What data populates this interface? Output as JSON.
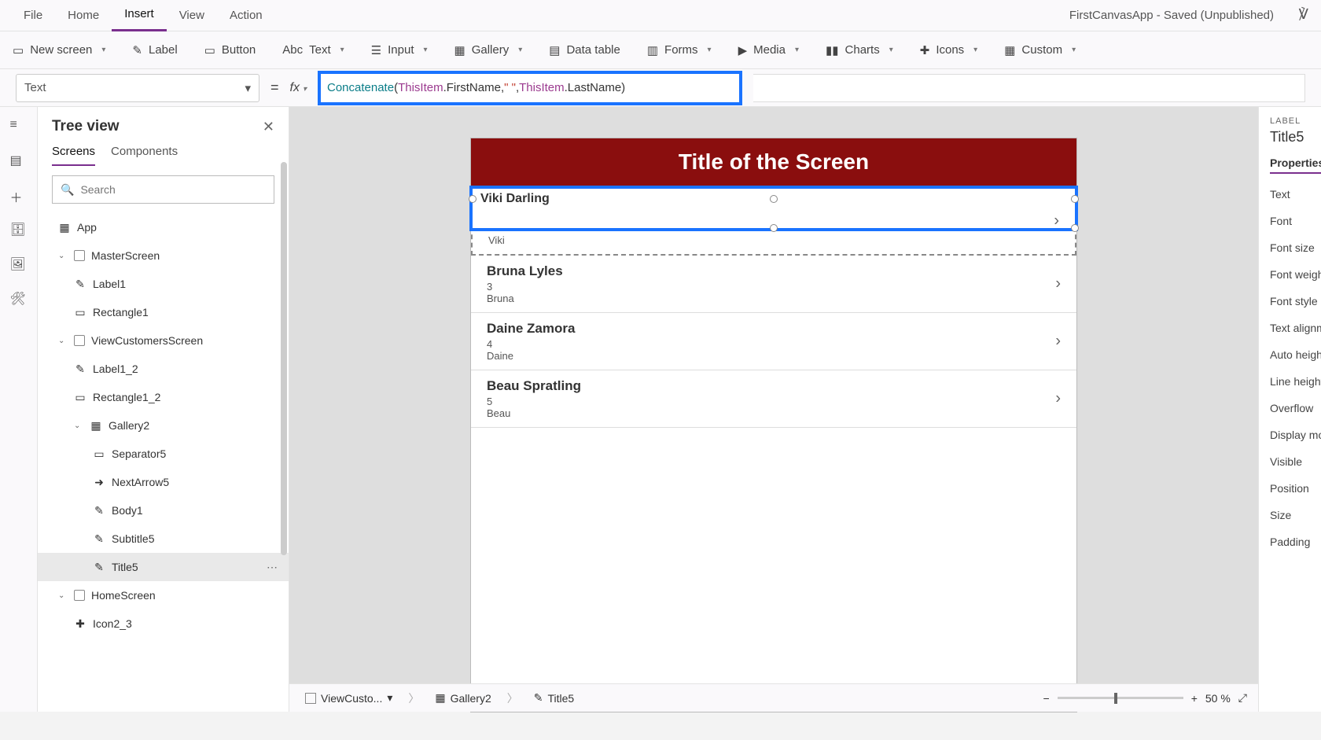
{
  "menu": {
    "items": [
      "File",
      "Home",
      "Insert",
      "View",
      "Action"
    ],
    "active": "Insert",
    "app_title": "FirstCanvasApp - Saved (Unpublished)"
  },
  "ribbon": {
    "new_screen": "New screen",
    "label": "Label",
    "button": "Button",
    "text": "Text",
    "input": "Input",
    "gallery": "Gallery",
    "data_table": "Data table",
    "forms": "Forms",
    "media": "Media",
    "charts": "Charts",
    "icons": "Icons",
    "custom": "Custom"
  },
  "formula": {
    "property": "Text",
    "fn": "Concatenate",
    "obj1": "ThisItem",
    "prop1": ".FirstName",
    "comma1": ", ",
    "str": "\" \"",
    "comma2": ", ",
    "obj2": "ThisItem",
    "prop2": ".LastName"
  },
  "tree": {
    "title": "Tree view",
    "tabs": {
      "screens": "Screens",
      "components": "Components"
    },
    "search_placeholder": "Search",
    "nodes": {
      "app": "App",
      "master": "MasterScreen",
      "label1": "Label1",
      "rect1": "Rectangle1",
      "view": "ViewCustomersScreen",
      "label1_2": "Label1_2",
      "rect1_2": "Rectangle1_2",
      "gallery2": "Gallery2",
      "sep5": "Separator5",
      "next5": "NextArrow5",
      "body1": "Body1",
      "sub5": "Subtitle5",
      "title5": "Title5",
      "home": "HomeScreen",
      "icon2_3": "Icon2_3"
    }
  },
  "canvas": {
    "title": "Title of the Screen",
    "selected_text": "Viki  Darling",
    "items": [
      {
        "title": "Viki  Darling",
        "subtitle": "",
        "body": "Viki"
      },
      {
        "title": "Bruna  Lyles",
        "subtitle": "3",
        "body": "Bruna"
      },
      {
        "title": "Daine  Zamora",
        "subtitle": "4",
        "body": "Daine"
      },
      {
        "title": "Beau  Spratling",
        "subtitle": "5",
        "body": "Beau"
      }
    ]
  },
  "breadcrumb": {
    "b1": "ViewCusto...",
    "b2": "Gallery2",
    "b3": "Title5",
    "zoom": "50  %"
  },
  "props": {
    "label": "LABEL",
    "name": "Title5",
    "tab": "Properties",
    "rows": [
      "Text",
      "Font",
      "Font size",
      "Font weight",
      "Font style",
      "Text alignme",
      "Auto height",
      "Line height",
      "Overflow",
      "Display mod",
      "Visible",
      "Position",
      "Size",
      "Padding"
    ]
  }
}
